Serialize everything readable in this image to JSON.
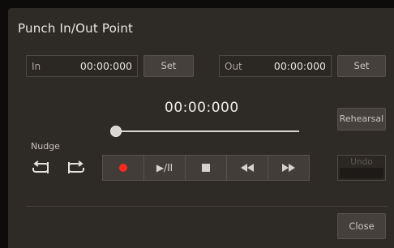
{
  "dialog": {
    "title": "Punch In/Out Point"
  },
  "punch_in": {
    "label": "In",
    "value": "00:00:000",
    "set_label": "Set"
  },
  "punch_out": {
    "label": "Out",
    "value": "00:00:000",
    "set_label": "Set"
  },
  "time_display": "00:00:000",
  "position_slider": {
    "value_fraction": 0.0
  },
  "nudge": {
    "label": "Nudge",
    "icons": [
      "nudge-back-icon",
      "nudge-forward-icon"
    ]
  },
  "transport": {
    "buttons": [
      {
        "name": "record",
        "icon": "record-icon"
      },
      {
        "name": "play-pause",
        "icon": "play-pause-icon",
        "label": "▶/II"
      },
      {
        "name": "stop",
        "icon": "stop-icon"
      },
      {
        "name": "rewind",
        "icon": "rewind-icon"
      },
      {
        "name": "fast-forward",
        "icon": "fast-forward-icon"
      }
    ]
  },
  "rehearsal_label": "Rehearsal",
  "undo_label": "Undo",
  "close_label": "Close",
  "colors": {
    "panel": "#2e2a26",
    "record": "#ff2a1f",
    "text": "#ece9e4",
    "button": "#45403b"
  }
}
